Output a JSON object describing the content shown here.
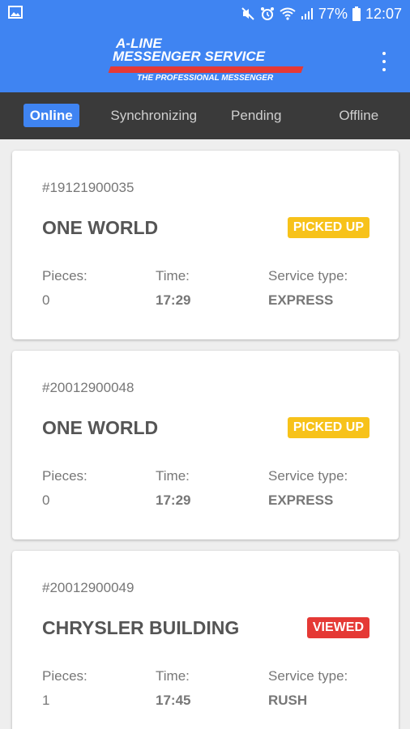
{
  "status_bar": {
    "battery": "77%",
    "time": "12:07",
    "icons": [
      "gallery-icon",
      "mute-icon",
      "alarm-icon",
      "wifi-icon",
      "signal-icon",
      "battery-icon"
    ]
  },
  "app_bar": {
    "logo": {
      "line1": "A-LINE",
      "line2": "MESSENGER SERVICE",
      "tagline": "THE PROFESSIONAL MESSENGER"
    },
    "menu_icon": "overflow-menu-icon"
  },
  "tabs": [
    {
      "label": "Online",
      "active": true
    },
    {
      "label": "Synchronizing",
      "active": false
    },
    {
      "label": "Pending",
      "active": false
    },
    {
      "label": "Offline",
      "active": false
    }
  ],
  "colors": {
    "primary": "#3f84f2",
    "tab_bar": "#3a3a3a",
    "picked_up": "#f7c21a",
    "viewed": "#e53935"
  },
  "jobs": [
    {
      "number": "#19121900035",
      "title": "ONE WORLD",
      "status": "PICKED UP",
      "pieces_label": "Pieces:",
      "pieces": "0",
      "time_label": "Time:",
      "time": "17:29",
      "service_label": "Service type:",
      "service": "EXPRESS"
    },
    {
      "number": "#20012900048",
      "title": "ONE WORLD",
      "status": "PICKED UP",
      "pieces_label": "Pieces:",
      "pieces": "0",
      "time_label": "Time:",
      "time": "17:29",
      "service_label": "Service type:",
      "service": "EXPRESS"
    },
    {
      "number": "#20012900049",
      "title": "CHRYSLER BUILDING",
      "status": "VIEWED",
      "pieces_label": "Pieces:",
      "pieces": "1",
      "time_label": "Time:",
      "time": "17:45",
      "service_label": "Service type:",
      "service": "RUSH"
    }
  ]
}
